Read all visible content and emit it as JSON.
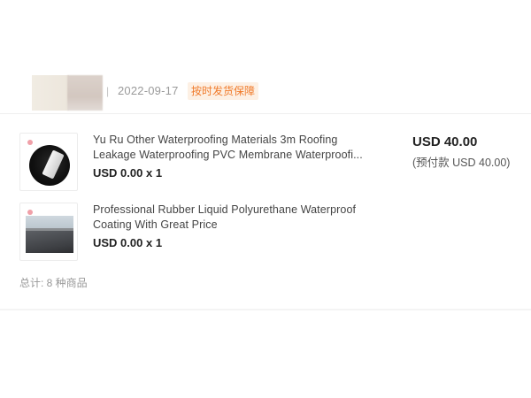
{
  "order": {
    "date": "2022-09-17",
    "separator": "|",
    "guarantee_badge": "按时发货保障"
  },
  "items": [
    {
      "title_line1": "Yu Ru Other Waterproofing Materials 3m Roofing",
      "title_line2": "Leakage Waterproofing PVC Membrane Waterproofi...",
      "price": "USD 0.00 x 1"
    },
    {
      "title_line1": "Professional Rubber Liquid Polyurethane Waterproof",
      "title_line2": "Coating With Great Price",
      "price": "USD 0.00 x 1"
    }
  ],
  "summary": {
    "total": "USD 40.00",
    "prepay": "(预付款 USD 40.00)",
    "item_count": "总计: 8 种商品"
  },
  "colors": {
    "badge_text": "#f07a2a",
    "badge_bg": "#fdf0e4"
  }
}
